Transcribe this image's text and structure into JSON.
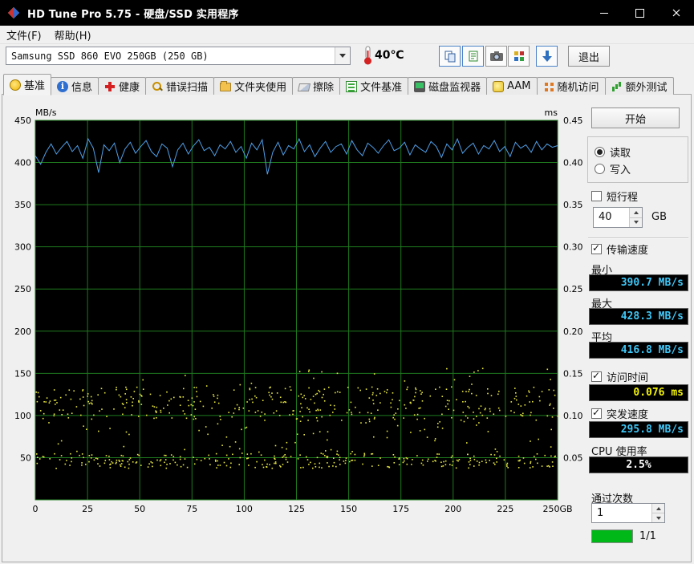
{
  "window": {
    "title": "HD Tune Pro 5.75 - 硬盘/SSD 实用程序"
  },
  "menu": {
    "file": "文件(F)",
    "help": "帮助(H)"
  },
  "toolbar": {
    "drive": "Samsung SSD 860 EVO 250GB (250 GB)",
    "temperature": "40℃",
    "exit": "退出"
  },
  "tabs": [
    {
      "id": "benchmark",
      "label": "基准",
      "icon": "benchmark-icon",
      "active": true
    },
    {
      "id": "info",
      "label": "信息",
      "icon": "info-icon",
      "active": false
    },
    {
      "id": "health",
      "label": "健康",
      "icon": "health-icon",
      "active": false
    },
    {
      "id": "error-scan",
      "label": "错误扫描",
      "icon": "error-scan-icon",
      "active": false
    },
    {
      "id": "folder-usage",
      "label": "文件夹使用",
      "icon": "folder-usage-icon",
      "active": false
    },
    {
      "id": "erase",
      "label": "擦除",
      "icon": "erase-icon",
      "active": false
    },
    {
      "id": "file-benchmark",
      "label": "文件基准",
      "icon": "file-benchmark-icon",
      "active": false
    },
    {
      "id": "disk-monitor",
      "label": "磁盘监视器",
      "icon": "disk-monitor-icon",
      "active": false
    },
    {
      "id": "aam",
      "label": "AAM",
      "icon": "aam-icon",
      "active": false
    },
    {
      "id": "random-access",
      "label": "随机访问",
      "icon": "random-access-icon",
      "active": false
    },
    {
      "id": "extra-tests",
      "label": "额外测试",
      "icon": "extra-tests-icon",
      "active": false
    }
  ],
  "chart": {
    "y_left_label": "MB/s",
    "y_right_label": "ms",
    "y_left_ticks": [
      450,
      400,
      350,
      300,
      250,
      200,
      150,
      100,
      50
    ],
    "y_left_max": 450,
    "y_right_ticks": [
      "0.45",
      "0.40",
      "0.35",
      "0.30",
      "0.25",
      "0.20",
      "0.15",
      "0.10",
      "0.05"
    ],
    "y_right_max": 0.45,
    "x_ticks": [
      "0",
      "25",
      "50",
      "75",
      "100",
      "125",
      "150",
      "175",
      "200",
      "225",
      "250GB"
    ]
  },
  "chart_data": {
    "type": "line",
    "xlabel_unit": "GB",
    "x_range": [
      0,
      250
    ],
    "series": [
      {
        "name": "传输速度",
        "unit": "MB/s",
        "axis": "left",
        "ylim": [
          0,
          450
        ],
        "values": [
          408,
          398,
          412,
          422,
          410,
          418,
          425,
          413,
          420,
          405,
          428,
          417,
          388,
          421,
          414,
          423,
          400,
          416,
          424,
          411,
          419,
          426,
          413,
          407,
          422,
          417,
          395,
          415,
          423,
          410,
          420,
          427,
          414,
          418,
          408,
          421,
          416,
          425,
          412,
          419,
          405,
          423,
          415,
          427,
          386,
          412,
          424,
          409,
          420,
          416,
          428,
          413,
          421,
          407,
          417,
          425,
          412,
          419,
          422,
          410,
          426,
          415,
          408,
          423,
          418,
          411,
          420,
          427,
          414,
          417,
          424,
          409,
          421,
          416,
          412,
          425,
          419,
          406,
          422,
          415,
          428,
          411,
          418,
          423,
          410,
          420,
          416,
          426,
          413,
          419,
          407,
          424,
          417,
          421,
          412,
          425,
          415,
          422,
          418,
          420
        ]
      },
      {
        "name": "访问时间",
        "unit": "ms",
        "axis": "right",
        "ylim": [
          0,
          0.45
        ],
        "type": "scatter_bands",
        "bands": [
          {
            "y_range": [
              0.095,
              0.135
            ],
            "count": 380
          },
          {
            "y_range": [
              0.038,
              0.056
            ],
            "count": 300
          },
          {
            "y_range": [
              0.056,
              0.095
            ],
            "count": 70
          },
          {
            "y_range": [
              0.135,
              0.158
            ],
            "count": 22
          }
        ]
      }
    ],
    "stats": {
      "min_mbs": 390.7,
      "max_mbs": 428.3,
      "avg_mbs": 416.8,
      "access_ms": 0.076,
      "burst_mbs": 295.8,
      "cpu_pct": 2.5
    }
  },
  "panel": {
    "start": "开始",
    "read": "读取",
    "write": "写入",
    "short_stroke": "短行程",
    "short_stroke_value": "40",
    "gb": "GB",
    "transfer_rate": "传输速度",
    "min_label": "最小",
    "min_value": "390.7 MB/s",
    "max_label": "最大",
    "max_value": "428.3 MB/s",
    "avg_label": "平均",
    "avg_value": "416.8 MB/s",
    "access_time": "访问时间",
    "access_value": "0.076 ms",
    "burst_rate": "突发速度",
    "burst_value": "295.8 MB/s",
    "cpu_label": "CPU 使用率",
    "cpu_value": "2.5%",
    "pass_label": "通过次数",
    "pass_value": "1",
    "progress": "1/1"
  },
  "colors": {
    "grid": "#1e7a1e",
    "line": "#4f9fe8",
    "dots": "#e8e840",
    "speed": "#3fc7f7",
    "access": "#f2f20a",
    "cpu": "#ffffff",
    "progress": "#00b818"
  }
}
